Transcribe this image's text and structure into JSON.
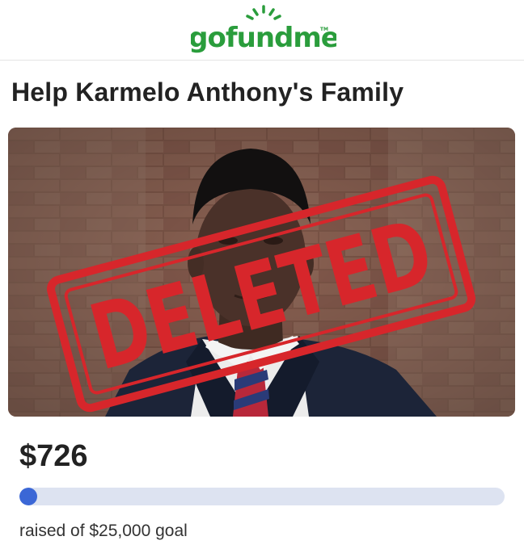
{
  "brand": {
    "logo_text": "gofundme",
    "trademark": "TM",
    "color": "#2a9d3c"
  },
  "campaign": {
    "title": "Help Karmelo Anthony's Family",
    "stamp_text": "DELETED",
    "stamp_color": "#d7262b"
  },
  "funding": {
    "amount_raised": "$726",
    "goal_text": "raised of $25,000 goal",
    "progress_fraction": 0.029,
    "progress_color": "#3b67d6"
  }
}
